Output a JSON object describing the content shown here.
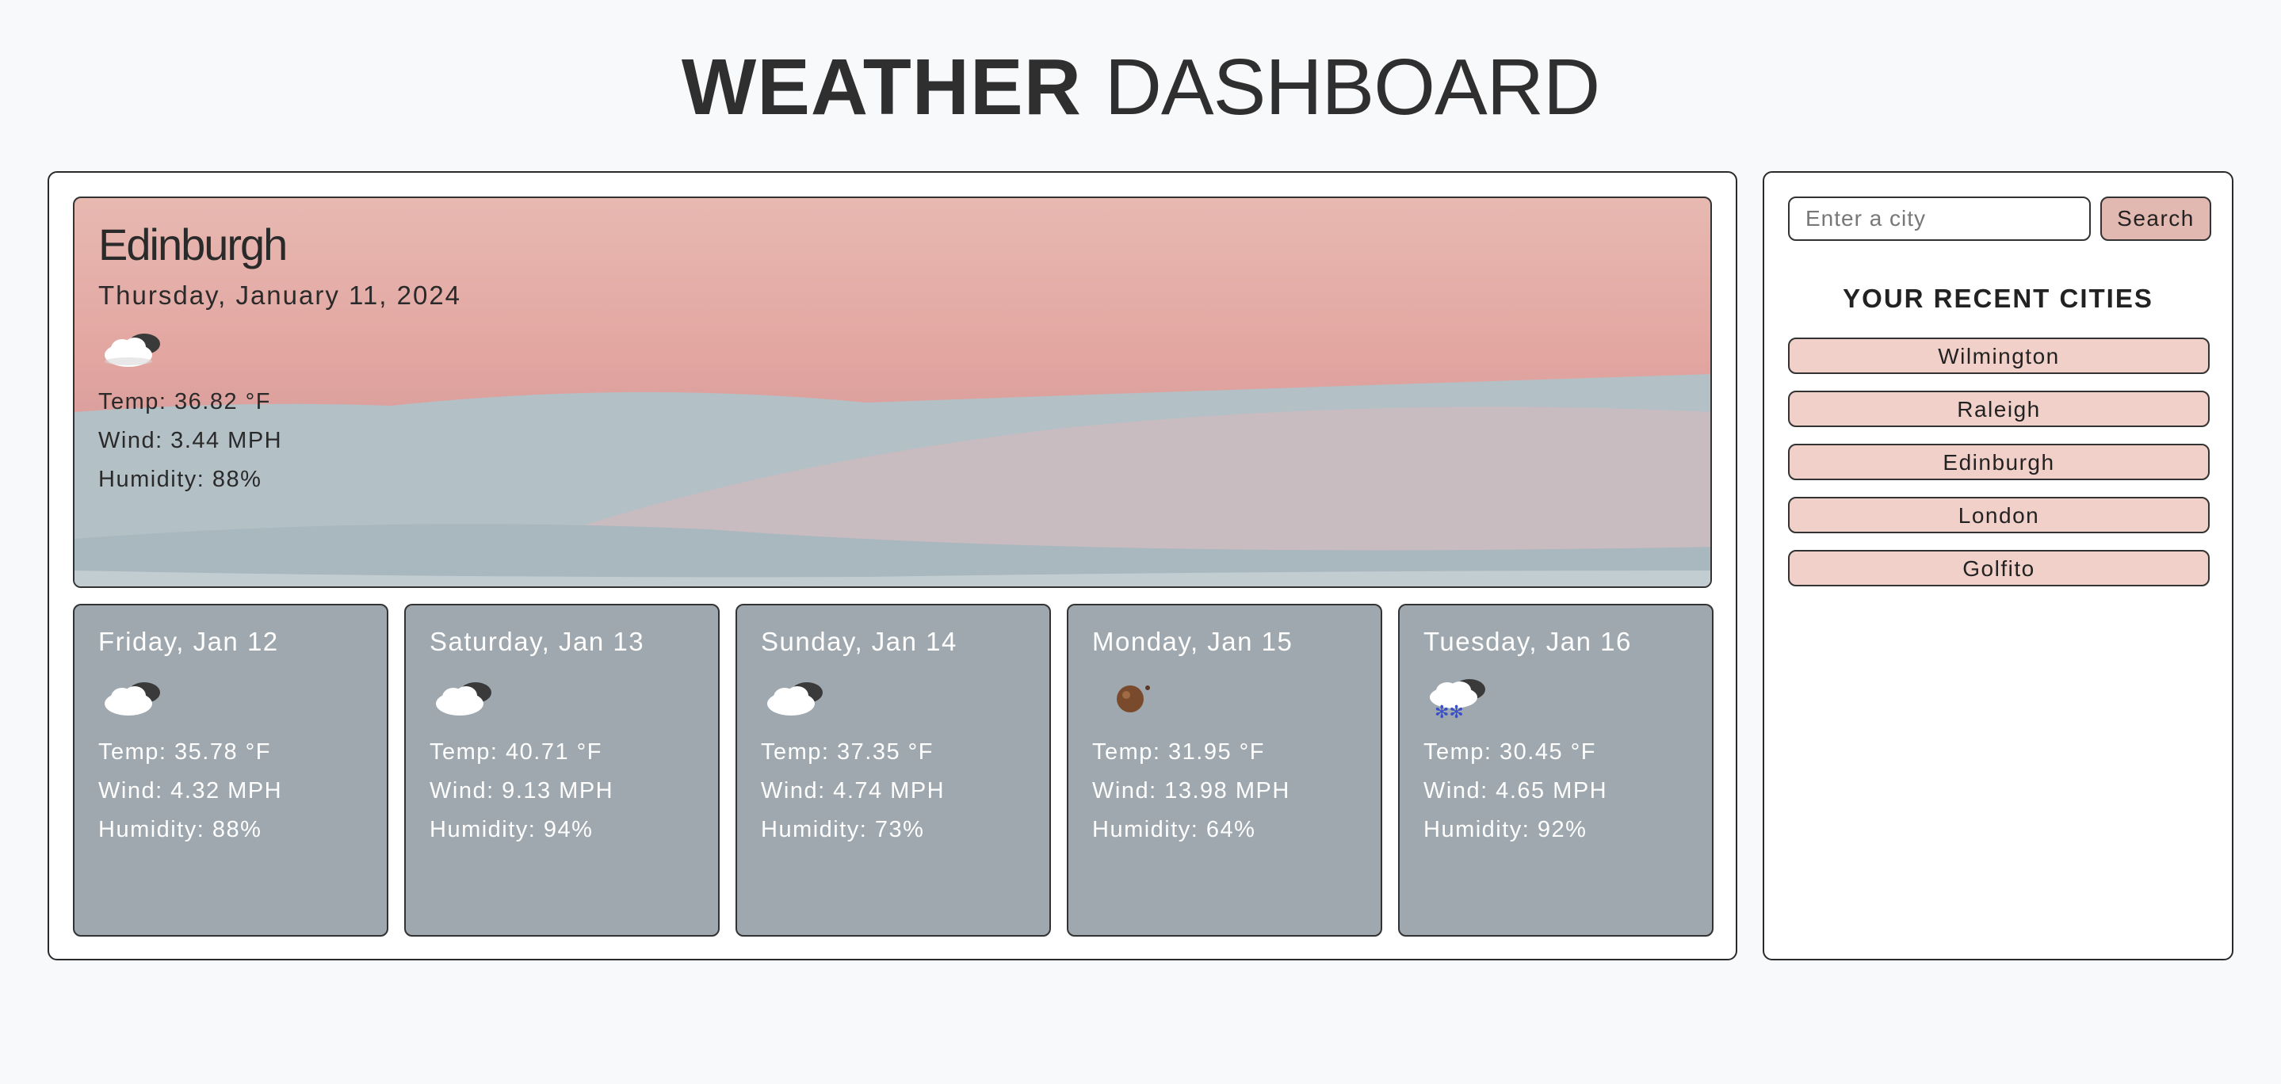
{
  "header": {
    "title_bold": "WEATHER",
    "title_light": "DASHBOARD"
  },
  "current": {
    "city": "Edinburgh",
    "date": "Thursday, January 11, 2024",
    "icon": "cloud-icon",
    "temp": "Temp: 36.82 °F",
    "wind": "Wind: 3.44 MPH",
    "humidity": "Humidity: 88%"
  },
  "forecast": [
    {
      "date": "Friday, Jan 12",
      "icon": "cloud-icon",
      "temp": "Temp: 35.78 °F",
      "wind": "Wind: 4.32 MPH",
      "humidity": "Humidity: 88%"
    },
    {
      "date": "Saturday, Jan 13",
      "icon": "cloud-icon",
      "temp": "Temp: 40.71 °F",
      "wind": "Wind: 9.13 MPH",
      "humidity": "Humidity: 94%"
    },
    {
      "date": "Sunday, Jan 14",
      "icon": "cloud-icon",
      "temp": "Temp: 37.35 °F",
      "wind": "Wind: 4.74 MPH",
      "humidity": "Humidity: 73%"
    },
    {
      "date": "Monday, Jan 15",
      "icon": "clear-night-icon",
      "temp": "Temp: 31.95 °F",
      "wind": "Wind: 13.98 MPH",
      "humidity": "Humidity: 64%"
    },
    {
      "date": "Tuesday, Jan 16",
      "icon": "snow-icon",
      "temp": "Temp: 30.45 °F",
      "wind": "Wind: 4.65 MPH",
      "humidity": "Humidity: 92%"
    }
  ],
  "search": {
    "placeholder": "Enter a city",
    "button": "Search"
  },
  "recent": {
    "title": "YOUR RECENT CITIES",
    "cities": [
      "Wilmington",
      "Raleigh",
      "Edinburgh",
      "London",
      "Golfito"
    ]
  },
  "colors": {
    "background": "#f8f9fb",
    "forecast_card": "#9ea8ae",
    "search_button": "#e2b9b1",
    "city_button": "#f0d0c8"
  }
}
